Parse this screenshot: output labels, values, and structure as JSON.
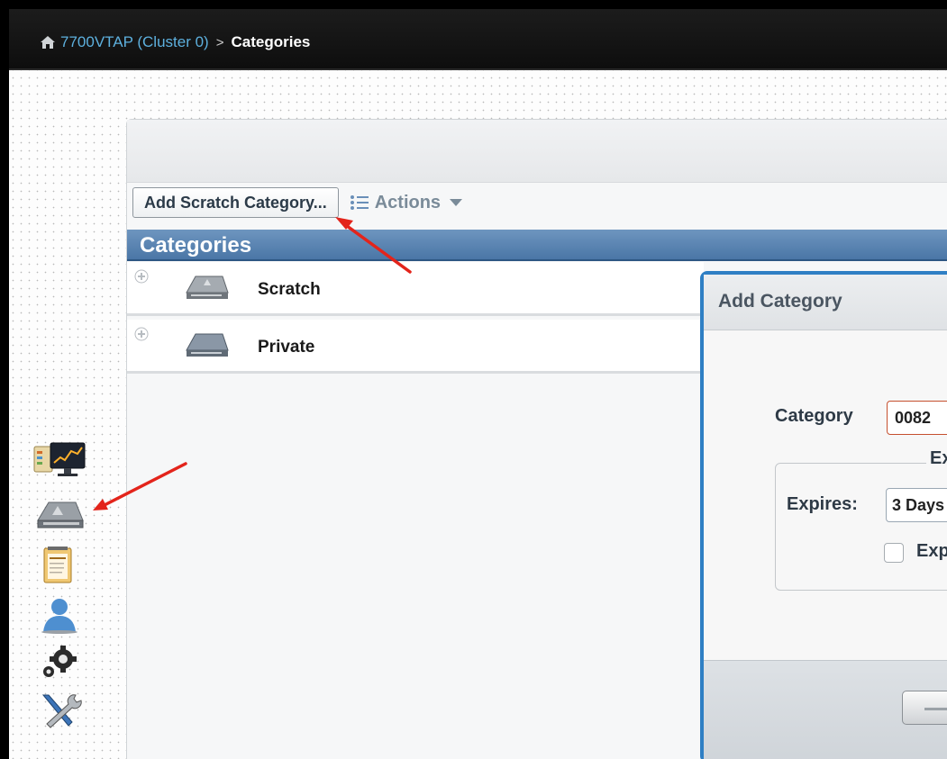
{
  "breadcrumb": {
    "home_icon": "home-icon",
    "link": "7700VTAP (Cluster 0)",
    "separator": ">",
    "current": "Categories"
  },
  "toolbar": {
    "add_button": "Add Scratch Category...",
    "actions_label": "Actions",
    "actions_icon": "list-icon"
  },
  "categories": {
    "header": "Categories",
    "rows": [
      {
        "name": "Scratch",
        "icon": "tape-cartridge-icon"
      },
      {
        "name": "Private",
        "icon": "tape-cartridge-icon"
      }
    ]
  },
  "dialog": {
    "title": "Add Category",
    "category_label": "Category",
    "category_value": "0082",
    "fieldset_legend": "Ex",
    "expires_label": "Expires:",
    "expires_value": "3 Days",
    "checkbox_label": "Exp"
  },
  "left_rail": {
    "icons": [
      "dashboard-icon",
      "tape-library-icon",
      "policies-icon",
      "user-icon",
      "settings-icon",
      "tools-icon"
    ]
  },
  "colors": {
    "accent_blue": "#2f7fc4",
    "header_blue": "#4a76a6",
    "annotation_red": "#e3241b",
    "breadcrumb_link": "#5db0de"
  }
}
